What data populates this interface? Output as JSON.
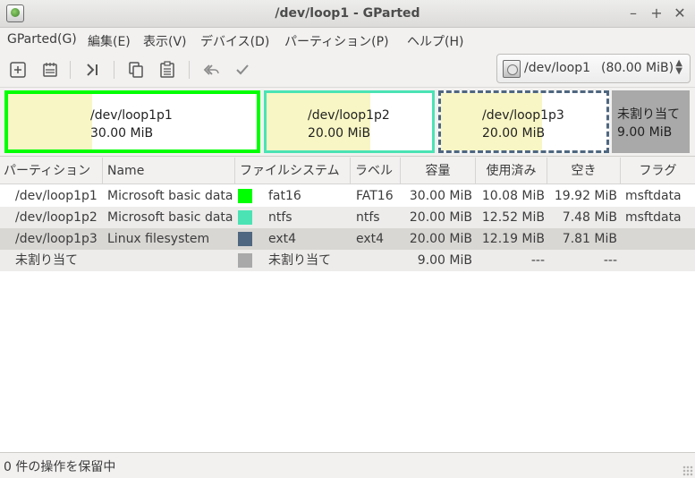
{
  "window": {
    "title": "/dev/loop1 - GParted",
    "minimize_glyph": "–",
    "maximize_glyph": "+",
    "close_glyph": "✕"
  },
  "menu": [
    "GParted(G)",
    "編集(E)",
    "表示(V)",
    "デバイス(D)",
    "パーティション(P)",
    "ヘルプ(H)"
  ],
  "toolbar": {
    "buttons": [
      "new-partition-icon",
      "delete-partition-icon",
      "resize-move-icon",
      "copy-icon",
      "paste-icon",
      "undo-icon",
      "apply-icon"
    ]
  },
  "device": {
    "name": "/dev/loop1",
    "size": "(80.00 MiB)"
  },
  "graph": {
    "partitions": [
      {
        "name": "/dev/loop1p1",
        "size": "30.00 MiB",
        "border_color": "#00ff00",
        "used_fraction": 0.337
      },
      {
        "name": "/dev/loop1p2",
        "size": "20.00 MiB",
        "border_color": "#4be3b4",
        "used_fraction": 0.626
      },
      {
        "name": "/dev/loop1p3",
        "size": "20.00 MiB",
        "border_color": "#4f6780",
        "used_fraction": 0.61
      }
    ],
    "unallocated": {
      "name": "未割り当て",
      "size": "9.00 MiB",
      "color": "#a9a9a9"
    }
  },
  "table": {
    "headers": [
      "パーティション",
      "Name",
      "ファイルシステム",
      "ラベル",
      "容量",
      "使用済み",
      "空き",
      "フラグ"
    ],
    "rows": [
      {
        "partition": "/dev/loop1p1",
        "name": "Microsoft basic data",
        "fs_color": "#00ff00",
        "filesystem": "fat16",
        "label": "FAT16",
        "size": "30.00 MiB",
        "used": "10.08 MiB",
        "free": "19.92 MiB",
        "flags": "msftdata"
      },
      {
        "partition": "/dev/loop1p2",
        "name": "Microsoft basic data",
        "fs_color": "#4be3b4",
        "filesystem": "ntfs",
        "label": "ntfs",
        "size": "20.00 MiB",
        "used": "12.52 MiB",
        "free": "7.48 MiB",
        "flags": "msftdata"
      },
      {
        "partition": "/dev/loop1p3",
        "name": "Linux filesystem",
        "fs_color": "#4f6780",
        "filesystem": "ext4",
        "label": "ext4",
        "size": "20.00 MiB",
        "used": "12.19 MiB",
        "free": "7.81 MiB",
        "flags": ""
      },
      {
        "partition": "未割り当て",
        "name": "",
        "fs_color": "#a9a9a9",
        "filesystem": "未割り当て",
        "label": "",
        "size": "9.00 MiB",
        "used": "---",
        "free": "---",
        "flags": ""
      }
    ]
  },
  "status": {
    "text": "0 件の操作を保留中"
  }
}
